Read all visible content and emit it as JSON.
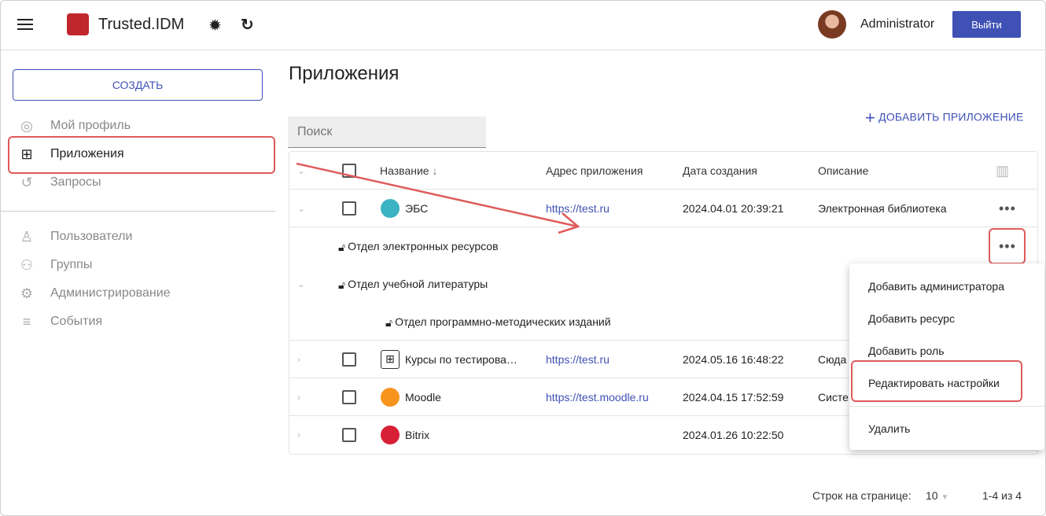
{
  "header": {
    "brand": "Trusted.IDM",
    "user": "Administrator",
    "logout": "Выйти",
    "icons": [
      "menu-icon",
      "theme-icon",
      "refresh-icon"
    ]
  },
  "sidebar": {
    "create": "СОЗДАТЬ",
    "items": [
      {
        "label": "Мой профиль",
        "icon": "account-circle-icon"
      },
      {
        "label": "Приложения",
        "icon": "apps-icon"
      },
      {
        "label": "Запросы",
        "icon": "history-icon"
      },
      {
        "label": "Пользователи",
        "icon": "person-icon"
      },
      {
        "label": "Группы",
        "icon": "group-icon"
      },
      {
        "label": "Администрирование",
        "icon": "gear-icon"
      },
      {
        "label": "События",
        "icon": "list-icon"
      }
    ]
  },
  "main": {
    "title": "Приложения",
    "add": "ДОБАВИТЬ ПРИЛОЖЕНИЕ",
    "search_placeholder": "Поиск",
    "columns": [
      "Название",
      "Адрес приложения",
      "Дата создания",
      "Описание"
    ],
    "rows": [
      {
        "name": "ЭБС",
        "url": "https://test.ru",
        "date": "2024.04.01 20:39:21",
        "desc": "Электронная библиотека"
      },
      {
        "name": "Курсы по тестирова…",
        "url": "https://test.ru",
        "date": "2024.05.16 16:48:22",
        "desc": "Сюда"
      },
      {
        "name": "Moodle",
        "url": "https://test.moodle.ru",
        "date": "2024.04.15 17:52:59",
        "desc": "Систе"
      },
      {
        "name": "Bitrix",
        "url": "",
        "date": "2024.01.26 10:22:50",
        "desc": ""
      }
    ],
    "resources": [
      "Отдел электронных ресурсов",
      "Отдел учебной литературы",
      "Отдел программно-методических изданий"
    ],
    "menu": [
      "Добавить администратора",
      "Добавить ресурс",
      "Добавить роль",
      "Редактировать настройки",
      "Удалить"
    ],
    "footer": {
      "rows_label": "Строк на странице:",
      "rows_value": "10",
      "range": "1-4 из 4"
    }
  },
  "colors": {
    "accent": "#3f51b5",
    "highlight": "#e05a5a"
  }
}
